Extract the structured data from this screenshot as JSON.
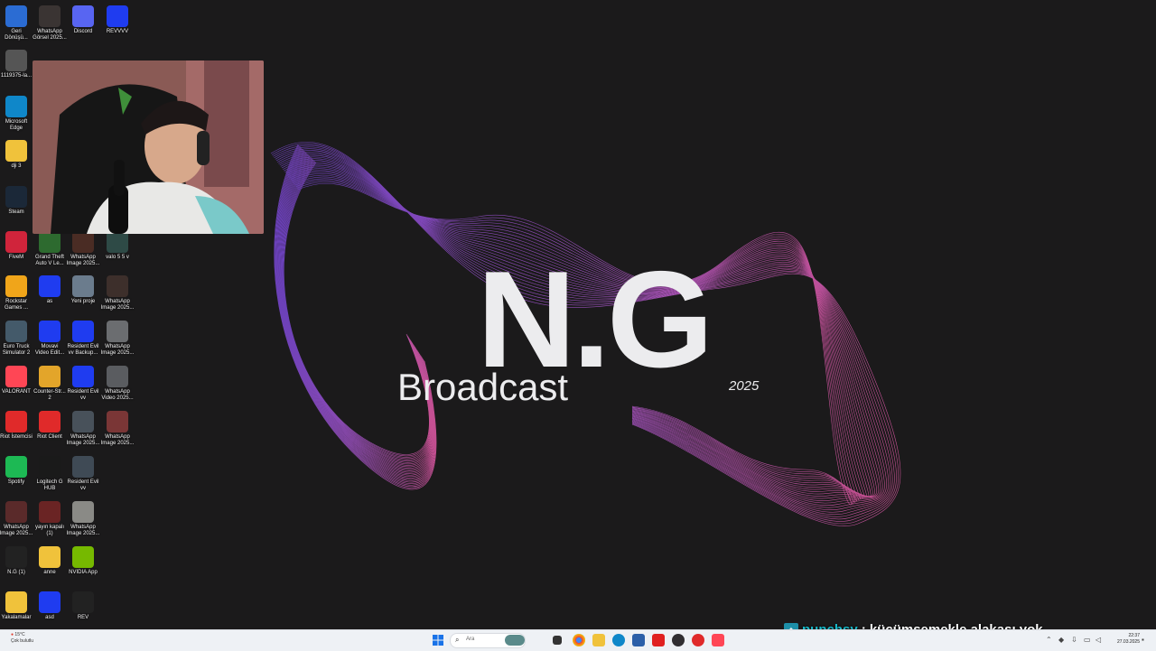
{
  "wallpaper": {
    "brand": "N.G",
    "subtitle": "Broadcast",
    "year": "2025",
    "wave_colors": [
      "#7a48d8",
      "#b45ad6",
      "#e45aa8"
    ]
  },
  "desktop_icons": [
    {
      "label": "Geri\nDönüşü...",
      "icon": "recycle-bin-icon",
      "color": "#2b6cd3"
    },
    {
      "label": "WhatsApp\nGörsel 2025...",
      "icon": "image-thumbnail-icon",
      "color": "#3a3433"
    },
    {
      "label": "Discord",
      "icon": "discord-icon",
      "color": "#5865f2"
    },
    {
      "label": "REVVVV",
      "icon": "blue-app-icon",
      "color": "#1f3cf0"
    },
    {
      "label": "1119375-la...",
      "icon": "image-thumbnail-icon",
      "color": "#555"
    },
    {
      "label": "Microsoft\nEdge",
      "icon": "edge-icon",
      "color": "#0f87c9"
    },
    {
      "label": "dji 3",
      "icon": "folder-icon",
      "color": "#f0c23b"
    },
    {
      "label": "Steam",
      "icon": "steam-icon",
      "color": "#1b2838"
    },
    {
      "label": "FiveM",
      "icon": "fivem-icon",
      "color": "#d0243b"
    },
    {
      "label": "Grand Theft\nAuto V Le...",
      "icon": "gta-icon",
      "color": "#2d6a2f"
    },
    {
      "label": "WhatsApp\nImage 2025...",
      "icon": "image-thumbnail-icon",
      "color": "#4a2c24"
    },
    {
      "label": "valo 5 5 v",
      "icon": "image-thumbnail-icon",
      "color": "#2e4a46"
    },
    {
      "label": "Rockstar\nGames ...",
      "icon": "rockstar-icon",
      "color": "#f0a51a"
    },
    {
      "label": "as",
      "icon": "blue-app-icon",
      "color": "#1f3cf0"
    },
    {
      "label": "Yeni proje",
      "icon": "image-thumbnail-icon",
      "color": "#6b7c8d"
    },
    {
      "label": "WhatsApp\nImage 2025...",
      "icon": "image-thumbnail-icon",
      "color": "#3d2f2b"
    },
    {
      "label": "Euro Truck\nSimulator 2",
      "icon": "euro-truck-icon",
      "color": "#445a6a"
    },
    {
      "label": "Movavi\nVideo Edit...",
      "icon": "blue-app-icon",
      "color": "#1f3cf0"
    },
    {
      "label": "Resident Evil\nvv Backup...",
      "icon": "blue-app-icon",
      "color": "#1f3cf0"
    },
    {
      "label": "WhatsApp\nImage 2025...",
      "icon": "image-thumbnail-icon",
      "color": "#6b6d70"
    },
    {
      "label": "VALORANT",
      "icon": "valorant-icon",
      "color": "#ff4655"
    },
    {
      "label": "Counter-Str...\n2",
      "icon": "counter-strike-icon",
      "color": "#e3a52a"
    },
    {
      "label": "Resident Evil\nvv",
      "icon": "blue-app-icon",
      "color": "#1f3cf0"
    },
    {
      "label": "WhatsApp\nVideo 2025...",
      "icon": "image-thumbnail-icon",
      "color": "#5a5c60"
    },
    {
      "label": "Riot İstemcisi",
      "icon": "riot-icon",
      "color": "#e02a2a"
    },
    {
      "label": "Riot Client",
      "icon": "riot-icon",
      "color": "#e02a2a"
    },
    {
      "label": "WhatsApp\nImage 2025...",
      "icon": "image-thumbnail-icon",
      "color": "#48515a"
    },
    {
      "label": "WhatsApp\nImage 2025...",
      "icon": "image-thumbnail-icon",
      "color": "#7a3636"
    },
    {
      "label": "Spotify",
      "icon": "spotify-icon",
      "color": "#1db954"
    },
    {
      "label": "Logitech G\nHUB",
      "icon": "logitech-icon",
      "color": "#1a1a1a"
    },
    {
      "label": "Resident Evil\nvv",
      "icon": "image-thumbnail-icon",
      "color": "#3f4a55"
    },
    {
      "label": "WhatsApp\nImage 2025...",
      "icon": "image-thumbnail-icon",
      "color": "#5a2a2a"
    },
    {
      "label": "yayın kapalı\n(1)",
      "icon": "image-thumbnail-icon",
      "color": "#6a2424"
    },
    {
      "label": "WhatsApp\nImage 2025...",
      "icon": "image-thumbnail-icon",
      "color": "#8a8a86"
    },
    {
      "label": "N.G (1)",
      "icon": "image-thumbnail-icon",
      "color": "#222"
    },
    {
      "label": "anne",
      "icon": "folder-icon",
      "color": "#f0c23b"
    },
    {
      "label": "NVIDIA App",
      "icon": "nvidia-icon",
      "color": "#76b900"
    },
    {
      "label": "Yakalamalar",
      "icon": "folder-icon",
      "color": "#f0c23b"
    },
    {
      "label": "asd",
      "icon": "blue-app-icon",
      "color": "#1f3cf0"
    },
    {
      "label": "REV",
      "icon": "image-thumbnail-icon",
      "color": "#222"
    }
  ],
  "chat_overlay": {
    "badge_icon": "subscriber-badge-icon",
    "username": "punchsy",
    "message": ": küçümsemekle alakası yok"
  },
  "taskbar": {
    "weather_temp": "15°C",
    "weather_desc": "Çok bulutlu",
    "search_placeholder": "Ara",
    "time": "22:37",
    "date": "27.03.2025"
  }
}
